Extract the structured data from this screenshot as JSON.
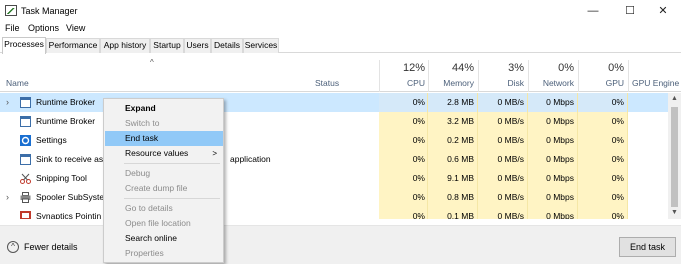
{
  "window": {
    "title": "Task Manager",
    "minimize": "—",
    "maximize": "☐",
    "close": "✕"
  },
  "menu": [
    "File",
    "Options",
    "View"
  ],
  "tabs": [
    "Processes",
    "Performance",
    "App history",
    "Startup",
    "Users",
    "Details",
    "Services"
  ],
  "header": {
    "sort_indicator": "^",
    "name": "Name",
    "status": "Status",
    "cpu_pct": "12%",
    "cpu": "CPU",
    "memory_pct": "44%",
    "memory": "Memory",
    "disk_pct": "3%",
    "disk": "Disk",
    "network_pct": "0%",
    "network": "Network",
    "gpu_pct": "0%",
    "gpu": "GPU",
    "gpu_engine": "GPU Engine"
  },
  "rows": [
    {
      "name": "Runtime Broker",
      "cpu": "0%",
      "memory": "2.8 MB",
      "disk": "0 MB/s",
      "network": "0 Mbps",
      "gpu": "0%",
      "expandable": true,
      "selected": true,
      "icon": "window-icon"
    },
    {
      "name": "Runtime Broker",
      "cpu": "0%",
      "memory": "3.2 MB",
      "disk": "0 MB/s",
      "network": "0 Mbps",
      "gpu": "0%",
      "icon": "window-icon"
    },
    {
      "name": "Settings",
      "cpu": "0%",
      "memory": "0.2 MB",
      "disk": "0 MB/s",
      "network": "0 Mbps",
      "gpu": "0%",
      "icon": "gear-icon"
    },
    {
      "name": "Sink to receive asy",
      "name_tail": "application",
      "cpu": "0%",
      "memory": "0.6 MB",
      "disk": "0 MB/s",
      "network": "0 Mbps",
      "gpu": "0%",
      "icon": "window-icon"
    },
    {
      "name": "Snipping Tool",
      "cpu": "0%",
      "memory": "9.1 MB",
      "disk": "0 MB/s",
      "network": "0 Mbps",
      "gpu": "0%",
      "icon": "scissors-icon"
    },
    {
      "name": "Spooler SubSysten",
      "cpu": "0%",
      "memory": "0.8 MB",
      "disk": "0 MB/s",
      "network": "0 Mbps",
      "gpu": "0%",
      "expandable": true,
      "icon": "printer-icon"
    },
    {
      "name": "Synaptics Pointin",
      "cpu": "0%",
      "memory": "0.1 MB",
      "disk": "0 MB/s",
      "network": "0 Mbps",
      "gpu": "0%",
      "icon": "touchpad-icon"
    }
  ],
  "context_menu": {
    "expand": "Expand",
    "switch_to": "Switch to",
    "end_task": "End task",
    "resource_values": "Resource values",
    "submenu_arrow": ">",
    "debug": "Debug",
    "create_dump": "Create dump file",
    "go_to_details": "Go to details",
    "open_file_location": "Open file location",
    "search_online": "Search online",
    "properties": "Properties"
  },
  "footer": {
    "fewer_details": "Fewer details",
    "end_task": "End task"
  },
  "colors": {
    "selected_row": "#cce8ff",
    "heat_cell": "#fff4c4",
    "menu_hover": "#91c9f7",
    "header_text": "#4c607a"
  }
}
